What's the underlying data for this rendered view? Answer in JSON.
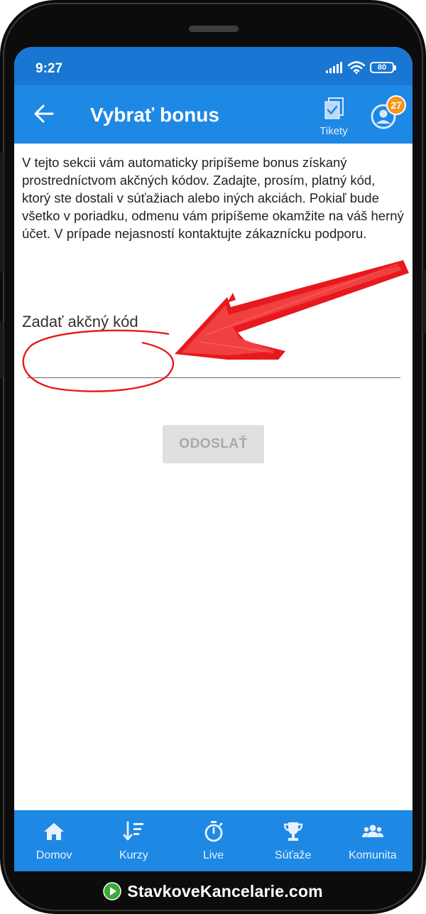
{
  "status_bar": {
    "time": "9:27",
    "battery": "80"
  },
  "app_bar": {
    "title": "Vybrať bonus",
    "tickets_label": "Tikety",
    "notifications_count": "27"
  },
  "content": {
    "intro_text": "V tejto sekcii vám automaticky pripíšeme bonus získaný prostredníctvom akčných kódov. Zadajte, prosím, platný kód, ktorý ste dostali v súťažiach alebo iných akciách. Pokiaľ bude všetko v poriadku, odmenu vám pripíšeme okamžite na váš herný účet. V prípade nejasností kontaktujte zákaznícku podporu.",
    "code_field_label": "Zadať akčný kód",
    "code_field_value": "",
    "submit_label": "ODOSLAŤ"
  },
  "bottom_nav": {
    "items": [
      {
        "label": "Domov",
        "icon": "home-icon"
      },
      {
        "label": "Kurzy",
        "icon": "sort-down-icon"
      },
      {
        "label": "Live",
        "icon": "stopwatch-icon"
      },
      {
        "label": "Súťaže",
        "icon": "trophy-icon"
      },
      {
        "label": "Komunita",
        "icon": "people-icon"
      }
    ]
  },
  "brand": {
    "text": "StavkoveKancelarie.com"
  },
  "colors": {
    "primary": "#1e88e5",
    "status_bar": "#1976d2",
    "badge": "#f7941d",
    "annotation": "#e8191e",
    "logo_green": "#3aa935"
  }
}
